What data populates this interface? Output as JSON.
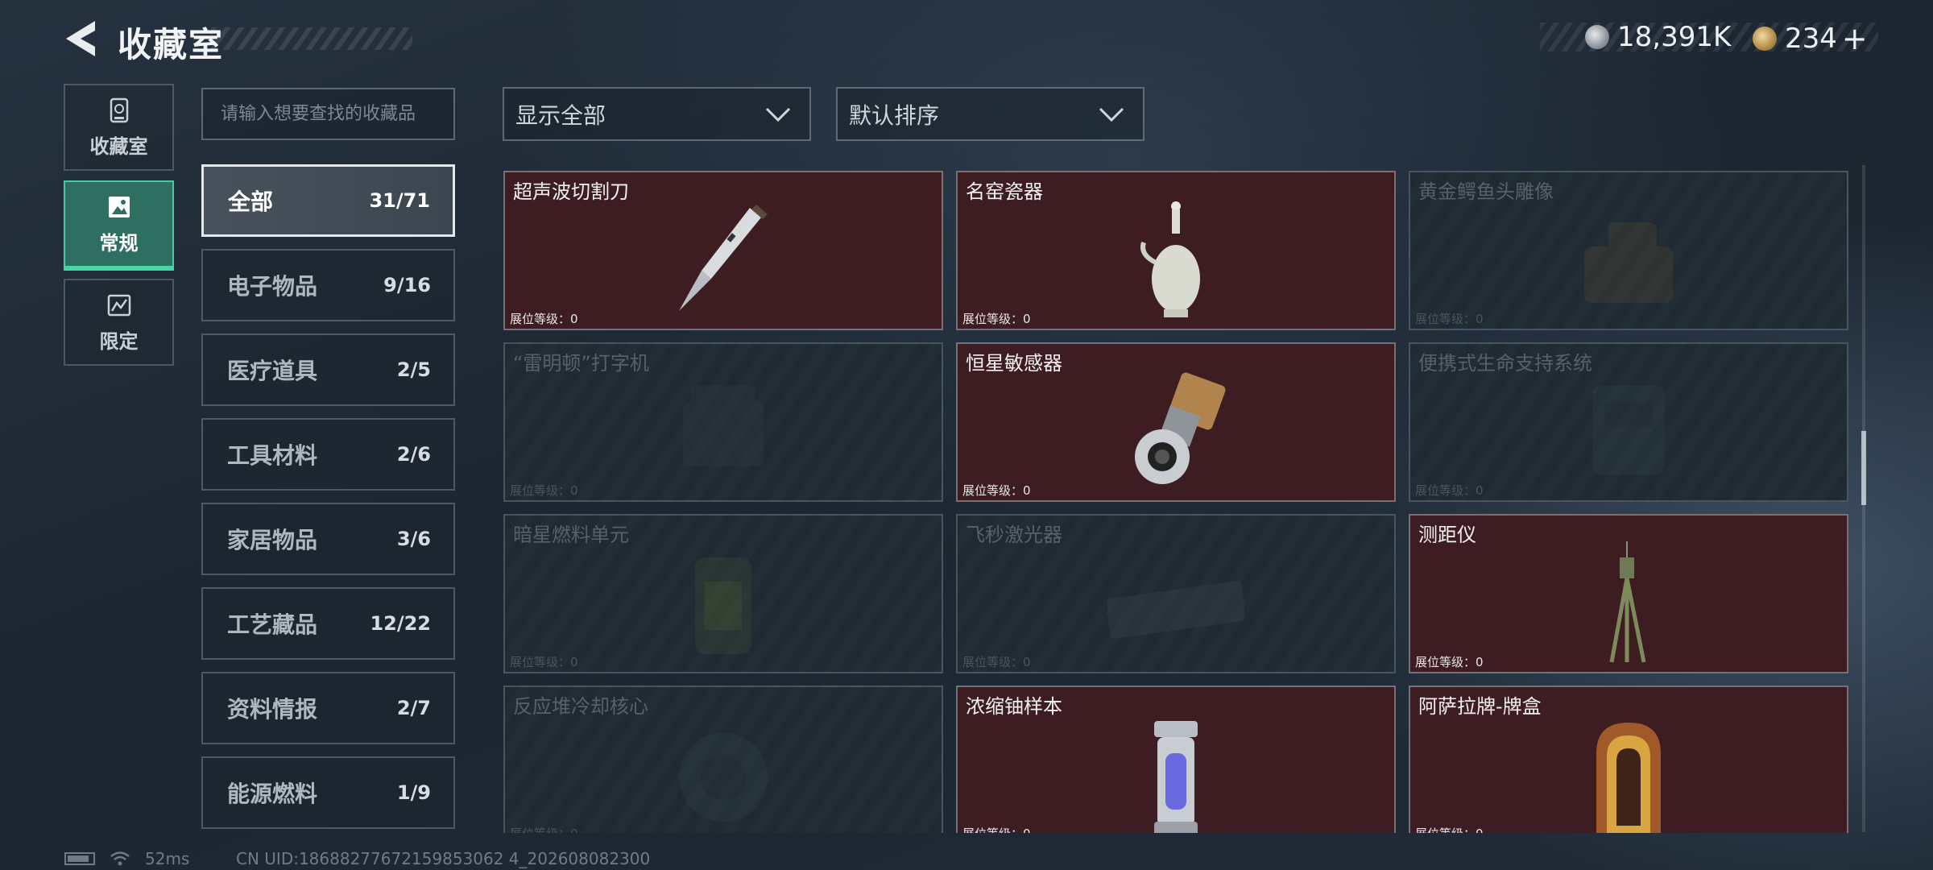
{
  "header": {
    "title": "收藏室",
    "currency_silver": "18,391K",
    "currency_gold": "234",
    "plus_label": "+"
  },
  "side_tabs": [
    {
      "label": "收藏室",
      "icon": "collection-room-icon",
      "active": false
    },
    {
      "label": "常规",
      "icon": "regular-collection-icon",
      "active": true
    },
    {
      "label": "限定",
      "icon": "limited-collection-icon",
      "active": false
    }
  ],
  "search": {
    "placeholder": "请输入想要查找的收藏品",
    "value": ""
  },
  "filters": {
    "display": "显示全部",
    "sort": "默认排序"
  },
  "categories": [
    {
      "name": "全部",
      "count": "31/71",
      "active": true
    },
    {
      "name": "电子物品",
      "count": "9/16"
    },
    {
      "name": "医疗道具",
      "count": "2/5"
    },
    {
      "name": "工具材料",
      "count": "2/6"
    },
    {
      "name": "家居物品",
      "count": "3/6"
    },
    {
      "name": "工艺藏品",
      "count": "12/22"
    },
    {
      "name": "资料情报",
      "count": "2/7"
    },
    {
      "name": "能源燃料",
      "count": "1/9"
    }
  ],
  "level_label": "展位等级：0",
  "items": [
    {
      "name": "超声波切割刀",
      "owned": true,
      "icon": "ultrasonic-knife-icon"
    },
    {
      "name": "名窑瓷器",
      "owned": true,
      "icon": "porcelain-vase-icon"
    },
    {
      "name": "黄金鳄鱼头雕像",
      "owned": false,
      "icon": "crocodile-statue-icon"
    },
    {
      "name": "“雷明顿”打字机",
      "owned": false,
      "icon": "typewriter-icon"
    },
    {
      "name": "恒星敏感器",
      "owned": true,
      "icon": "star-sensor-icon"
    },
    {
      "name": "便携式生命支持系统",
      "owned": false,
      "icon": "life-support-icon"
    },
    {
      "name": "暗星燃料单元",
      "owned": false,
      "icon": "fuel-cell-icon"
    },
    {
      "name": "飞秒激光器",
      "owned": false,
      "icon": "laser-icon"
    },
    {
      "name": "测距仪",
      "owned": true,
      "icon": "rangefinder-icon"
    },
    {
      "name": "反应堆冷却核心",
      "owned": false,
      "icon": "reactor-core-icon"
    },
    {
      "name": "浓缩铀样本",
      "owned": true,
      "icon": "uranium-sample-icon"
    },
    {
      "name": "阿萨拉牌-牌盒",
      "owned": true,
      "icon": "card-box-icon"
    }
  ],
  "footer": {
    "ping": "52ms",
    "uid": "CN UID:18688277672159853062 4_202608082300"
  }
}
